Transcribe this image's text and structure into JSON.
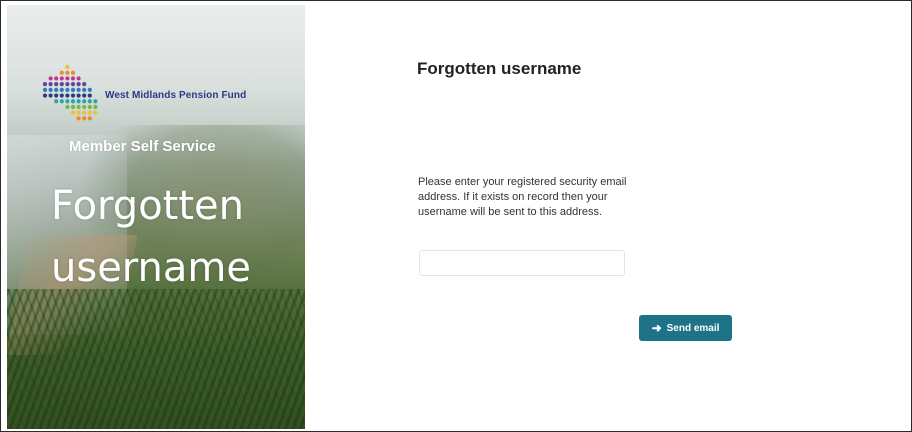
{
  "brand": {
    "logo_name": "West Midlands Pension Fund",
    "service_label": "Member Self Service",
    "colors": {
      "navy": "#2a3b86",
      "magenta": "#c2368b",
      "purple": "#6b3fa0",
      "teal": "#2aa7a8",
      "green": "#7ab648",
      "yellow": "#e8c23a",
      "orange": "#f08a24",
      "blue": "#2f79c1"
    }
  },
  "hero": {
    "title_line1": "Forgotten",
    "title_line2": "username"
  },
  "form": {
    "title": "Forgotten username",
    "instructions": "Please enter your registered security email address. If it exists on record then your username will be sent to this address.",
    "email_value": "",
    "email_placeholder": "",
    "submit_label": "Send email",
    "submit_icon": "arrow-right-icon",
    "accent": "#1e7389"
  }
}
